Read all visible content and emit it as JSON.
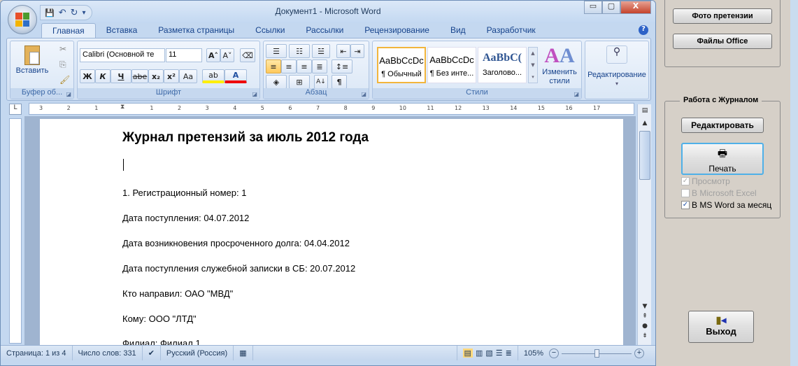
{
  "window": {
    "title": "Документ1 - Microsoft Word",
    "minimize": "▭",
    "maximize": "▢",
    "close": "X"
  },
  "qat": {
    "save": "💾",
    "undo": "↶",
    "redo": "↻",
    "customize": "▾"
  },
  "tabs": [
    "Главная",
    "Вставка",
    "Разметка страницы",
    "Ссылки",
    "Рассылки",
    "Рецензирование",
    "Вид",
    "Разработчик"
  ],
  "ribbon": {
    "clipboard": {
      "label": "Буфер об...",
      "paste": "Вставить"
    },
    "font": {
      "label": "Шрифт",
      "font_name": "Calibri (Основной те",
      "font_size": "11",
      "bold": "Ж",
      "italic": "К",
      "underline": "Ч",
      "strike": "abe",
      "sub": "x₂",
      "sup": "x²",
      "case": "Aa",
      "grow": "A˄",
      "shrink": "A˅"
    },
    "paragraph": {
      "label": "Абзац",
      "pilcrow": "¶"
    },
    "styles": {
      "label": "Стили",
      "items": [
        {
          "sample": "AaBbCcDc",
          "name": "¶ Обычный"
        },
        {
          "sample": "AaBbCcDc",
          "name": "¶ Без инте..."
        },
        {
          "sample": "AaBbC(",
          "name": "Заголово..."
        }
      ],
      "change": "Изменить стили"
    },
    "editing": {
      "label": "Редактирование"
    }
  },
  "ruler": {
    "numbers": [
      "3",
      "2",
      "1",
      "",
      "1",
      "2",
      "3",
      "4",
      "5",
      "6",
      "7",
      "8",
      "9",
      "10",
      "11",
      "12",
      "13",
      "14",
      "15",
      "16",
      "17"
    ]
  },
  "document": {
    "heading": "Журнал претензий  за июль 2012 года",
    "paragraphs": [
      "1. Регистрационный  номер:  1",
      "Дата поступления:  04.07.2012",
      "Дата возникновения  просроченного долга:  04.04.2012",
      "Дата поступления служебной записки  в СБ:  20.07.2012",
      "Кто направил: ОАО \"МВД\"",
      "Кому: ООО \"ЛТД\"",
      "Филиал: Филиал 1"
    ]
  },
  "status": {
    "page": "Страница: 1 из 4",
    "words": "Число слов: 331",
    "language": "Русский (Россия)",
    "zoom": "105%",
    "zoom_percent": 105
  },
  "panel": {
    "photo_button": "Фото претензии",
    "office_files_button": "Файлы Office",
    "journal_group": "Работа с Журналом",
    "edit_button": "Редактировать",
    "print_button": "Печать",
    "checkboxes": [
      {
        "label": "Просмотр",
        "checked": true,
        "enabled": false
      },
      {
        "label": "В Microsoft Excel",
        "checked": false,
        "enabled": false
      },
      {
        "label": "В MS Word за месяц",
        "checked": true,
        "enabled": true
      }
    ],
    "exit_button": "Выход"
  }
}
